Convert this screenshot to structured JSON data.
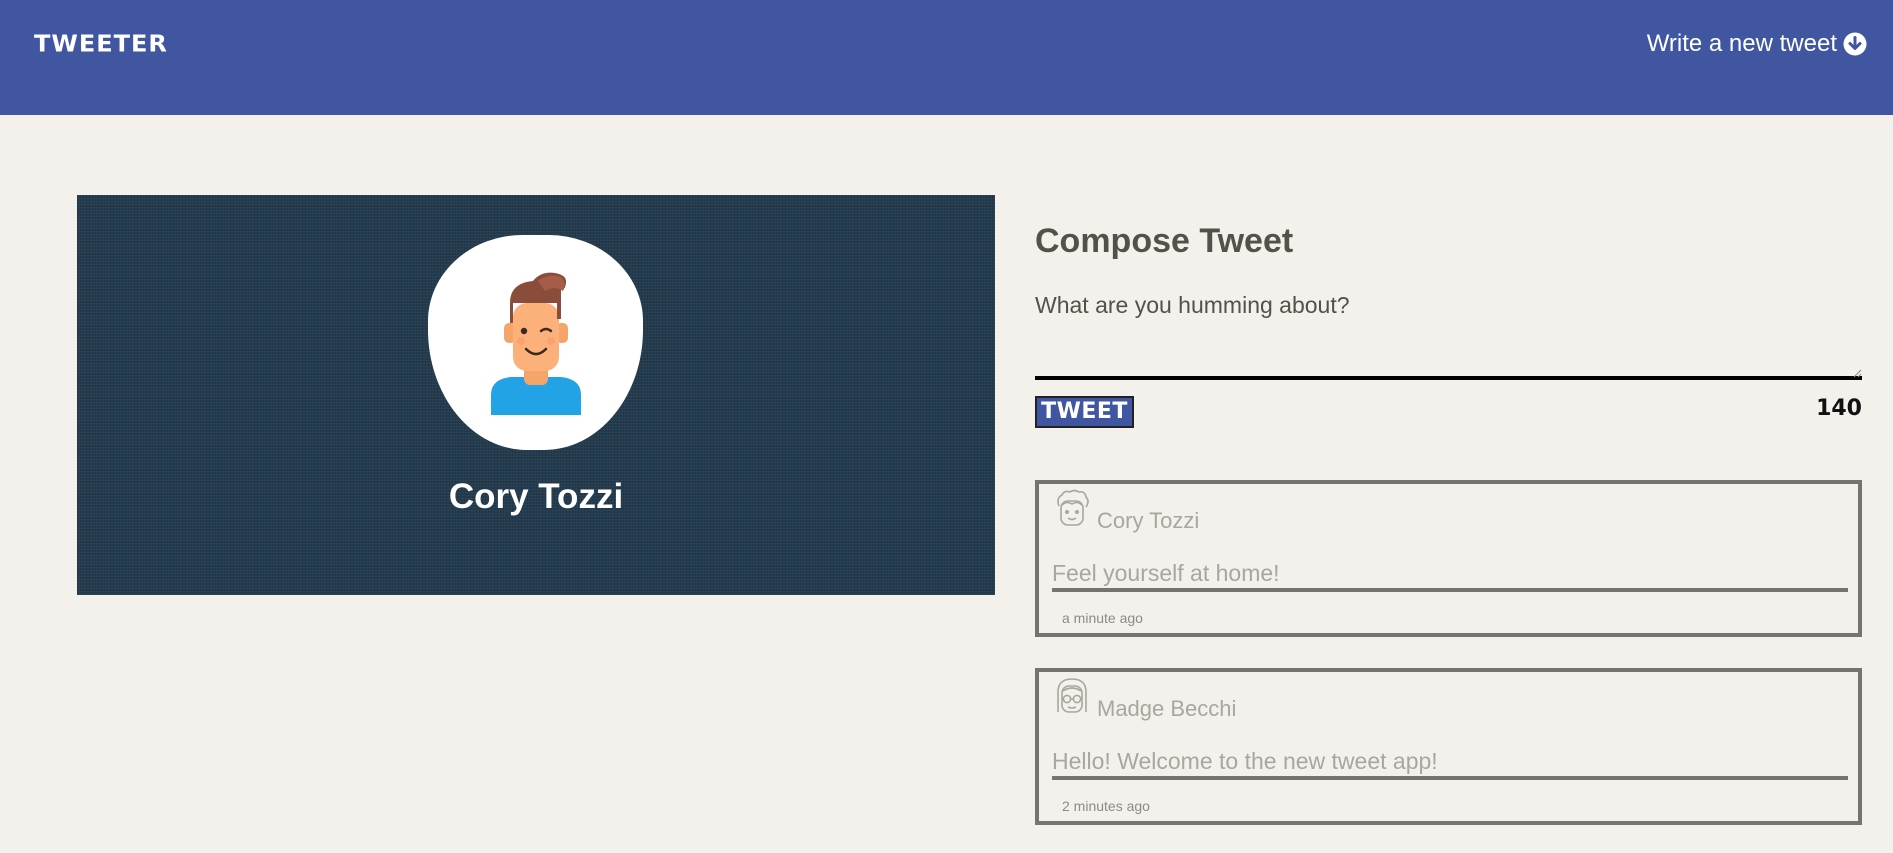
{
  "nav": {
    "brand": "TWEETER",
    "write_new": "Write a new tweet",
    "write_new_icon": "arrow-down-circle-icon"
  },
  "profile": {
    "name": "Cory Tozzi",
    "avatar_icon": "winking-boy-avatar"
  },
  "compose": {
    "title": "Compose Tweet",
    "placeholder": "What are you humming about?",
    "button_label": "TWEET",
    "counter": "140"
  },
  "tweets": [
    {
      "name": "Cory Tozzi",
      "text": "Feel yourself at home!",
      "time": "a minute ago",
      "avatar_icon": "curly-hair-face-icon"
    },
    {
      "name": "Madge Becchi",
      "text": "Hello! Welcome to the new tweet app!",
      "time": "2 minutes ago",
      "avatar_icon": "glasses-face-icon"
    }
  ],
  "colors": {
    "nav_bg": "#4056a0",
    "page_bg": "#f4f1ec",
    "profile_bg": "#243c4f",
    "text": "#545149",
    "tweet_border": "#77746f",
    "tweet_text": "#a9a69f"
  }
}
